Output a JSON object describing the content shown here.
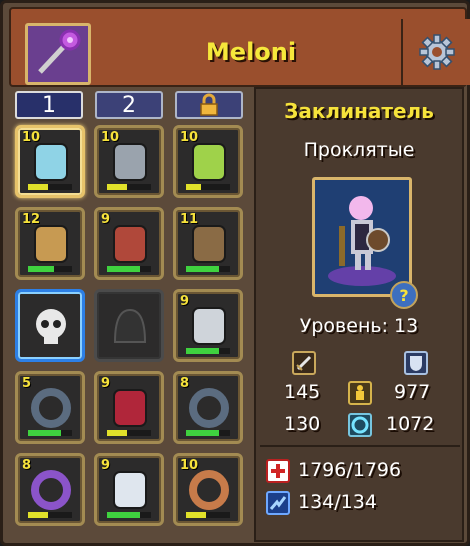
{
  "header": {
    "player_name": "Meloni"
  },
  "tabs": [
    {
      "label": "1",
      "active": true
    },
    {
      "label": "2",
      "active": false
    },
    {
      "label": "",
      "icon": "lock-icon",
      "locked": true
    }
  ],
  "slots": [
    {
      "name": "cloak",
      "level": "10",
      "bar_fill": 0.45,
      "bar_color": "#e1e12a"
    },
    {
      "name": "helmet",
      "level": "10",
      "bar_fill": 0.45,
      "bar_color": "#e1e12a"
    },
    {
      "name": "amulet",
      "level": "10",
      "bar_fill": 0.35,
      "bar_color": "#e1e12a"
    },
    {
      "name": "mace",
      "level": "12",
      "bar_fill": 0.6,
      "bar_color": "#3fd23f"
    },
    {
      "name": "armor",
      "level": "9",
      "bar_fill": 0.75,
      "bar_color": "#3fd23f"
    },
    {
      "name": "shield",
      "level": "11",
      "bar_fill": 0.75,
      "bar_color": "#3fd23f"
    },
    {
      "name": "skull-relic",
      "level": "",
      "bar_fill": 0,
      "bar_color": "#3fd23f"
    },
    {
      "name": "empty-slot",
      "level": "",
      "bar_fill": 0,
      "bar_color": "#3fd23f"
    },
    {
      "name": "bracer",
      "level": "9",
      "bar_fill": 0.75,
      "bar_color": "#3fd23f"
    },
    {
      "name": "chain-ring",
      "level": "5",
      "bar_fill": 0.75,
      "bar_color": "#3fd23f"
    },
    {
      "name": "belt",
      "level": "9",
      "bar_fill": 0.45,
      "bar_color": "#e1e12a"
    },
    {
      "name": "chain-ring-2",
      "level": "8",
      "bar_fill": 0.75,
      "bar_color": "#3fd23f"
    },
    {
      "name": "ring",
      "level": "8",
      "bar_fill": 0.45,
      "bar_color": "#e1e12a"
    },
    {
      "name": "boots",
      "level": "9",
      "bar_fill": 0.75,
      "bar_color": "#3fd23f"
    },
    {
      "name": "bracelet",
      "level": "10",
      "bar_fill": 0.45,
      "bar_color": "#e1e12a"
    }
  ],
  "hero": {
    "class_name": "Заклинатель",
    "faction": "Проклятые",
    "level_text": "Уровень: 13",
    "help_glyph": "?"
  },
  "stats": {
    "attack": "145",
    "defense": "977",
    "health_stat": "130",
    "mana_stat": "1072",
    "hp": "1796/1796",
    "mp": "134/134"
  },
  "colors": {
    "accent_yellow": "#f6e23b",
    "panel": "#4a3a2e",
    "header": "#9a4f2d"
  }
}
